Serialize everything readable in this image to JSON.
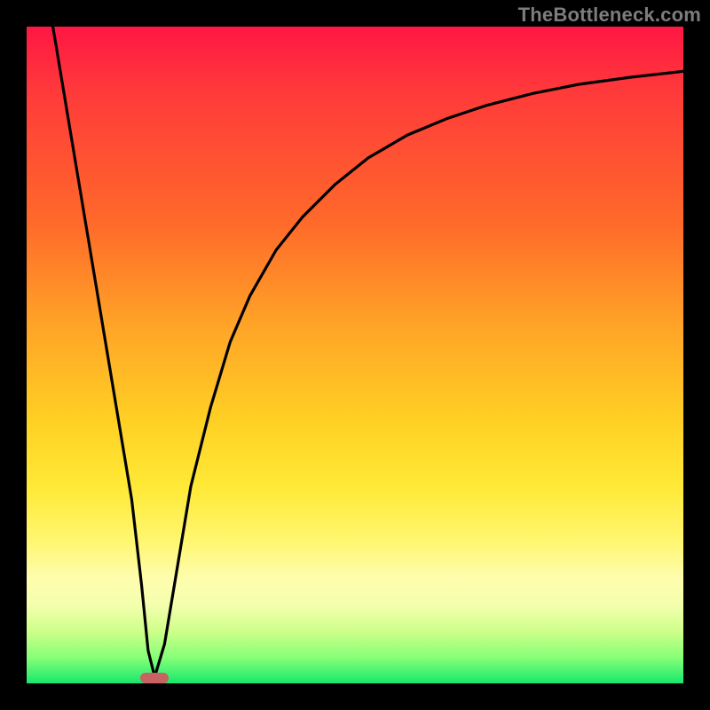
{
  "watermark": "TheBottleneck.com",
  "chart_data": {
    "type": "line",
    "title": "",
    "xlabel": "",
    "ylabel": "",
    "xlim": [
      0,
      100
    ],
    "ylim": [
      0,
      100
    ],
    "x": [
      4,
      6,
      8,
      10,
      12,
      14,
      16,
      17.5,
      18.5,
      19.5,
      21,
      23,
      25,
      28,
      31,
      34,
      38,
      42,
      47,
      52,
      58,
      64,
      70,
      77,
      84,
      92,
      100
    ],
    "values": [
      100,
      88,
      76,
      64,
      52,
      40,
      28,
      15,
      5,
      1,
      6,
      18,
      30,
      42,
      52,
      59,
      66,
      71,
      76,
      80,
      83.5,
      86,
      88,
      89.8,
      91.2,
      92.3,
      93.2
    ],
    "legend": [],
    "gradient_axis": "y",
    "optimum_x": 19.5,
    "marker": {
      "shape": "pill",
      "color": "#c96262"
    }
  },
  "marker_style_left": "left:128px",
  "marker_style_top": "top:727px"
}
